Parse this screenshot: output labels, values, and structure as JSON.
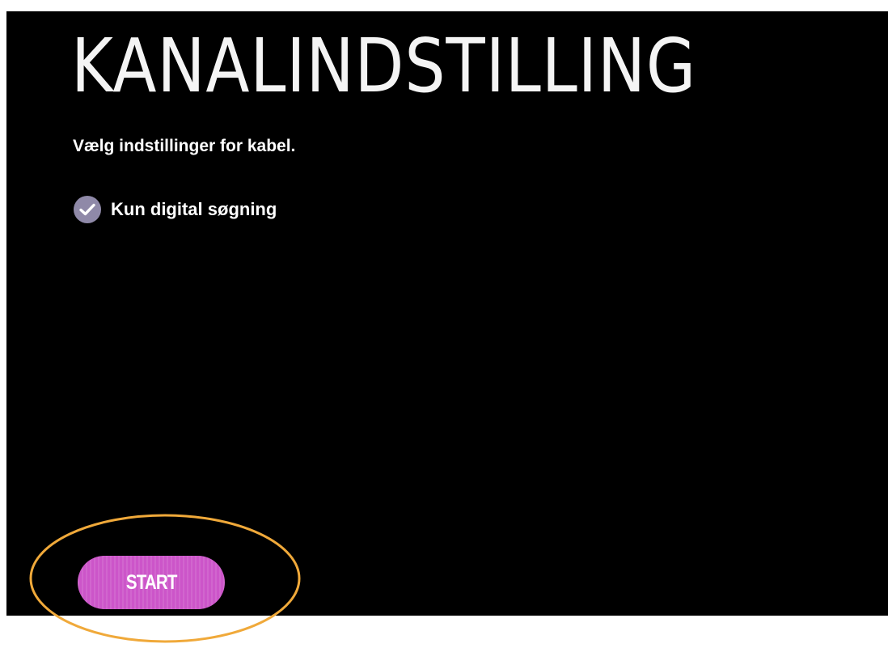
{
  "screen": {
    "title": "KANALINDSTILLING",
    "subtitle": "Vælg indstillinger for kabel."
  },
  "options": [
    {
      "label": "Kun digital søgning",
      "checked": true,
      "icon": "checkmark-icon"
    }
  ],
  "actions": {
    "start_label": "START"
  },
  "colors": {
    "background": "#000000",
    "start_button": "#cc55c9",
    "checkbox_fill": "#8f89a8",
    "highlight_ring": "#f0a93a"
  }
}
